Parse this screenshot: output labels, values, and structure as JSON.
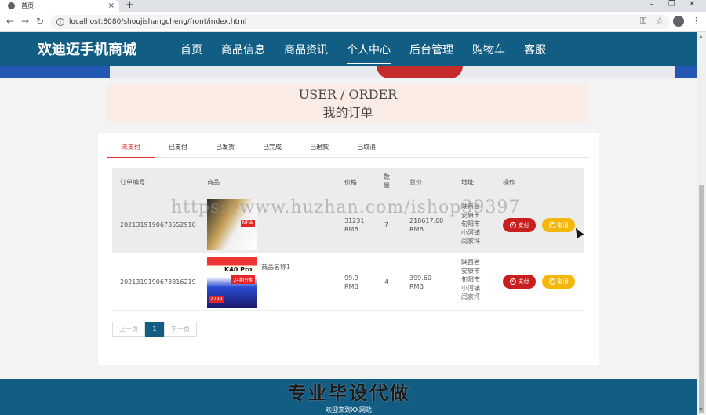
{
  "browser": {
    "tab_title": "首页",
    "tab_close": "×",
    "new_tab": "+",
    "url": "localhost:8080/shoujishangcheng/front/index.html",
    "window_controls": [
      "–",
      "❐",
      "✕"
    ]
  },
  "header": {
    "brand": "欢迪迈手机商城",
    "menu": [
      {
        "label": "首页",
        "active": false
      },
      {
        "label": "商品信息",
        "active": false
      },
      {
        "label": "商品资讯",
        "active": false
      },
      {
        "label": "个人中心",
        "active": true
      },
      {
        "label": "后台管理",
        "active": false
      },
      {
        "label": "购物车",
        "active": false
      },
      {
        "label": "客服",
        "active": false
      }
    ]
  },
  "title": {
    "en": "USER / ORDER",
    "zh": "我的订单"
  },
  "order_tabs": [
    {
      "label": "未支付",
      "active": true
    },
    {
      "label": "已支付",
      "active": false
    },
    {
      "label": "已发货",
      "active": false
    },
    {
      "label": "已完成",
      "active": false
    },
    {
      "label": "已退款",
      "active": false
    },
    {
      "label": "已取消",
      "active": false
    }
  ],
  "table": {
    "headers": {
      "order_no": "订单编号",
      "product": "商品",
      "price": "价格",
      "qty": "数量",
      "total": "总价",
      "address": "地址",
      "action": "操作"
    },
    "rows": [
      {
        "order_no": "2021319190673552910",
        "product_name": "",
        "price": "31231 RMB",
        "qty": "7",
        "total": "218617.00 RMB",
        "address": "陕西省 安康市 旬阳市 小河镇 闫家坪",
        "pay": "支付",
        "cancel": "取消"
      },
      {
        "order_no": "2021319190673816219",
        "product_name": "商品名称1",
        "price": "99.9 RMB",
        "qty": "4",
        "total": "399.60 RMB",
        "address": "陕西省 安康市 旬阳市 小河镇 闫家坪",
        "pay": "支付",
        "cancel": "取消"
      }
    ]
  },
  "product_images": {
    "k40_text": "K40 Pro",
    "k40_price": "2799",
    "badge": "24期分期"
  },
  "pager": {
    "prev": "上一页",
    "current": "1",
    "next": "下一页"
  },
  "watermark": "https://www.huzhan.com/ishop39397",
  "footer": {
    "big": "专业毕设代做",
    "small": "欢迎来到XX网站"
  }
}
